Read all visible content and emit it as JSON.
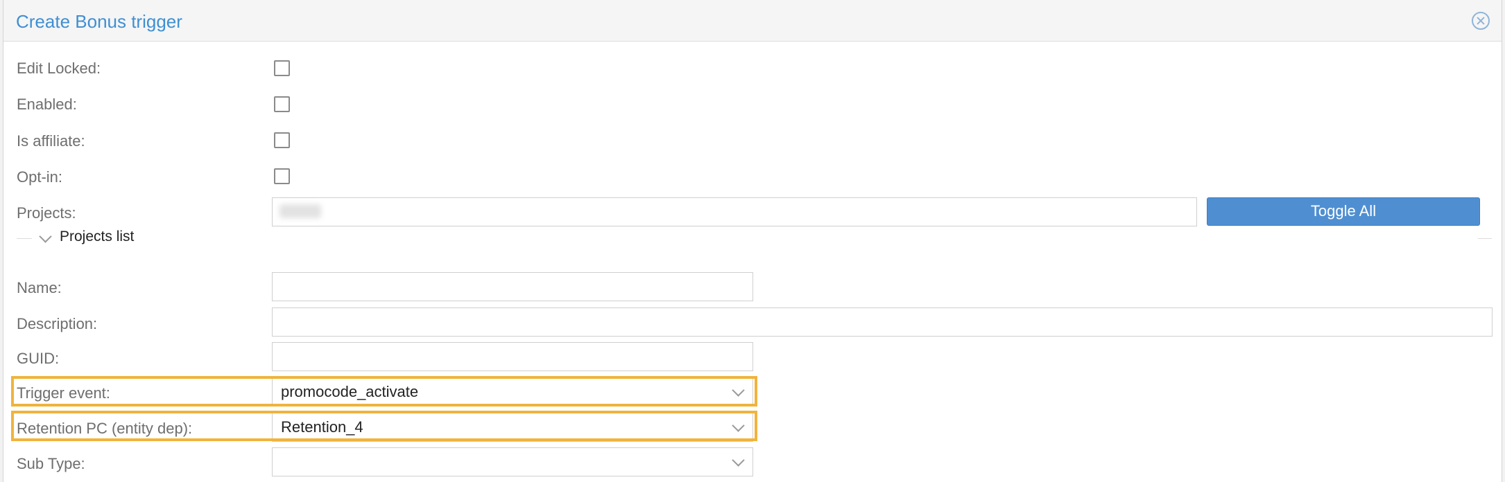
{
  "dialog": {
    "title": "Create Bonus trigger"
  },
  "form": {
    "edit_locked_label": "Edit Locked:",
    "enabled_label": "Enabled:",
    "is_affiliate_label": "Is affiliate:",
    "opt_in_label": "Opt-in:",
    "projects_label": "Projects:",
    "toggle_all_label": "Toggle All",
    "projects_list_title": "Projects list",
    "name_label": "Name:",
    "description_label": "Description:",
    "guid_label": "GUID:",
    "trigger_event_label": "Trigger event:",
    "trigger_event_value": "promocode_activate",
    "retention_label": "Retention PC (entity dep):",
    "retention_value": "Retention_4",
    "sub_type_label": "Sub Type:",
    "sub_type_value": ""
  },
  "checkboxes": {
    "edit_locked": false,
    "enabled": false,
    "is_affiliate": false,
    "opt_in": false
  },
  "colors": {
    "title": "#3f8fd2",
    "primary_button": "#4f8fd1",
    "highlight": "#f0b43c"
  }
}
